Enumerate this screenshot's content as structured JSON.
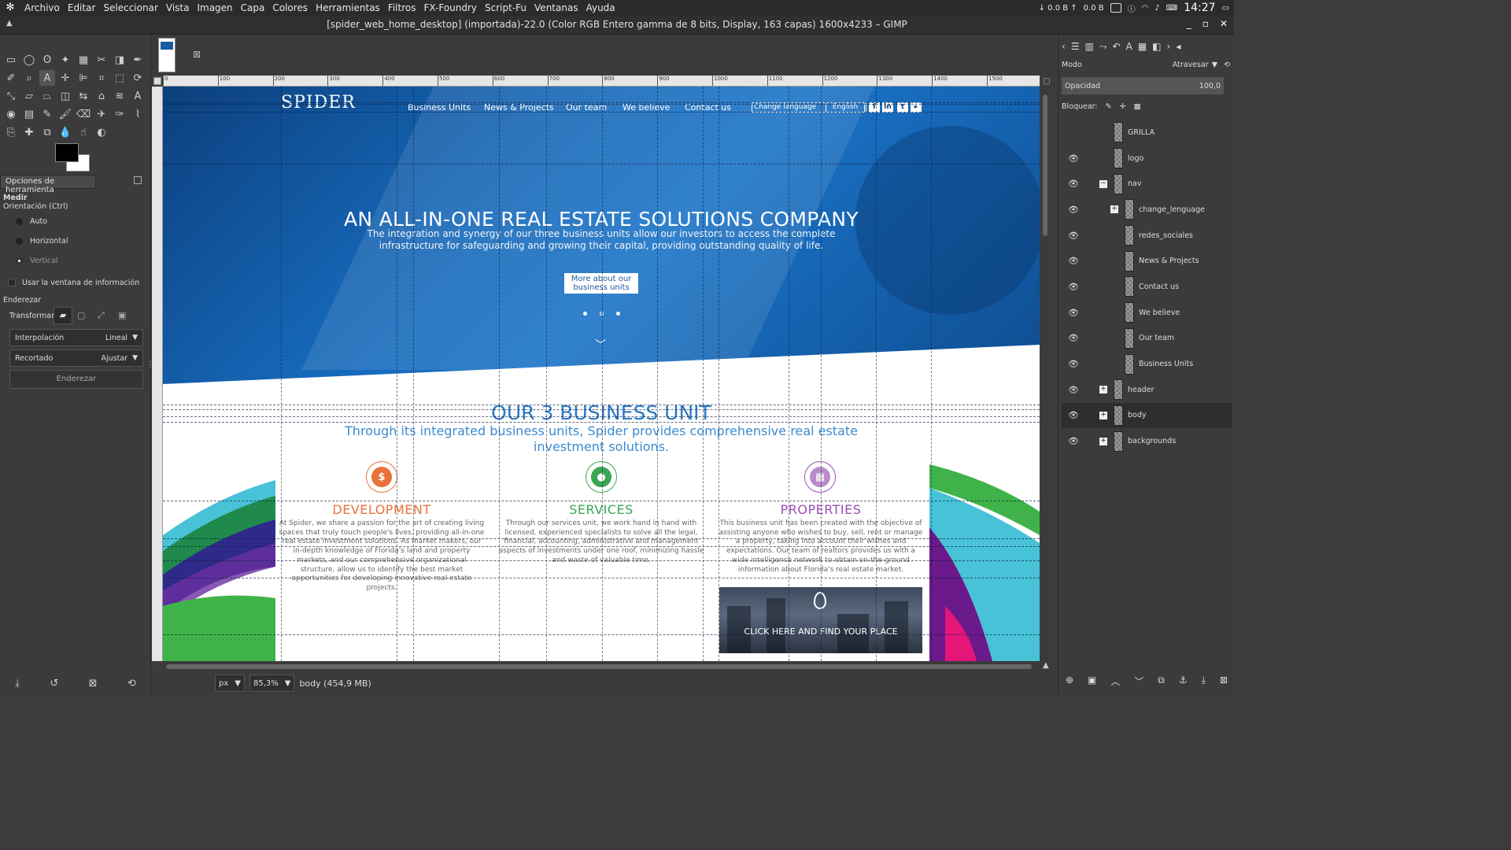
{
  "menubar": {
    "items": [
      "Archivo",
      "Editar",
      "Seleccionar",
      "Vista",
      "Imagen",
      "Capa",
      "Colores",
      "Herramientas",
      "Filtros",
      "FX-Foundry",
      "Script-Fu",
      "Ventanas",
      "Ayuda"
    ],
    "tray_down": "↓ 0.0 B ↑",
    "tray_up": "0.0 B",
    "clock": "14:27"
  },
  "window": {
    "title": "[spider_web_home_desktop] (importada)-22.0 (Color RGB Entero gamma de 8 bits, Display, 163 capas) 1600x4233 – GIMP"
  },
  "toolbox": {
    "tab_label": "Opciones de herramienta",
    "tool_name": "Medir",
    "orientation_label": "Orientación  (Ctrl)",
    "orientation_options": [
      "Auto",
      "Horizontal",
      "Vertical"
    ],
    "selected_orientation": "Vertical",
    "info_window_label": "Usar la ventana de información",
    "straighten_label": "Enderezar",
    "transform_label": "Transformar:",
    "interpolation_label": "Interpolación",
    "interpolation_value": "Lineal",
    "clipping_label": "Recortado",
    "clipping_value": "Ajustar",
    "straighten_button": "Enderezar"
  },
  "rulers": {
    "h_ticks": [
      "0",
      "100",
      "200",
      "300",
      "400",
      "500",
      "600",
      "700",
      "800",
      "900",
      "1000",
      "1100",
      "1200",
      "1300",
      "1400",
      "1500"
    ]
  },
  "website": {
    "logo": "SPIDER",
    "nav": [
      "Business Units",
      "News & Projects",
      "Our team",
      "We believe",
      "Contact us"
    ],
    "change_language": "Change language",
    "language": "English",
    "social": [
      "f",
      "in",
      "t",
      "▸"
    ],
    "hero_title": "AN ALL-IN-ONE REAL ESTATE SOLUTIONS COMPANY",
    "hero_subtitle": "The integration and synergy of our three business units allow our investors to access the complete infrastructure for safeguarding and growing their capital, providing outstanding quality of life.",
    "hero_button": "More about our business units",
    "section_title": "OUR 3 BUSINESS UNIT",
    "section_subtitle": "Through its integrated business units, Spider provides comprehensive real estate investment solutions.",
    "units": [
      {
        "title": "DEVELOPMENT",
        "color": "#e8723a",
        "icon": "dollar-icon",
        "text": "At Spider, we share a passion for the art of creating living spaces that truly touch people's lives, providing all-in-one real estate investment solutions. As market makers, our in-depth knowledge of Florida's land and property markets, and our comprehensive organizational structure, allow us to identify the best market opportunities for developing innovative real estate projects."
      },
      {
        "title": "SERVICES",
        "color": "#3aa655",
        "icon": "person-icon",
        "text": "Through our services unit, we work hand in hand with licensed, experienced specialists to solve all the legal, financial, accounting, administrative and management aspects of investments under one roof, minimizing hassle and waste of valuable time."
      },
      {
        "title": "PROPERTIES",
        "color": "#9a4fb5",
        "icon": "building-icon",
        "text": "This business unit has been created with the objective of assisting anyone who wishes to buy, sell, rent or manage a property, taking into account their wishes and expectations. Our team of realtors provides us with a wide intelligence network to obtain on-the-ground information about Florida's real estate market."
      }
    ],
    "properties_cta": "CLICK HERE AND FIND YOUR PLACE"
  },
  "statusbar": {
    "unit": "px",
    "zoom": "85,3%",
    "layer_info": "body (454,9 MB)"
  },
  "layers_panel": {
    "mode_label": "Modo",
    "mode_value": "Atravesar",
    "opacity_label": "Opacidad",
    "opacity_value": "100,0",
    "lock_label": "Bloquear:",
    "layers": [
      {
        "name": "GRILLA",
        "visible": false,
        "indent": 2,
        "expander": ""
      },
      {
        "name": "logo",
        "visible": true,
        "indent": 2,
        "expander": ""
      },
      {
        "name": "nav",
        "visible": true,
        "indent": 2,
        "expander": "−"
      },
      {
        "name": "change_lenguage",
        "visible": true,
        "indent": 3,
        "expander": "+"
      },
      {
        "name": "redes_sociales",
        "visible": true,
        "indent": 3,
        "expander": ""
      },
      {
        "name": "News & Projects",
        "visible": true,
        "indent": 3,
        "expander": ""
      },
      {
        "name": "Contact us",
        "visible": true,
        "indent": 3,
        "expander": ""
      },
      {
        "name": "We believe",
        "visible": true,
        "indent": 3,
        "expander": ""
      },
      {
        "name": "Our team",
        "visible": true,
        "indent": 3,
        "expander": ""
      },
      {
        "name": "Business Units",
        "visible": true,
        "indent": 3,
        "expander": ""
      },
      {
        "name": "header",
        "visible": true,
        "indent": 1,
        "expander": "+"
      },
      {
        "name": "body",
        "visible": true,
        "indent": 1,
        "expander": "+",
        "selected": true
      },
      {
        "name": "backgrounds",
        "visible": true,
        "indent": 1,
        "expander": "+"
      }
    ]
  }
}
